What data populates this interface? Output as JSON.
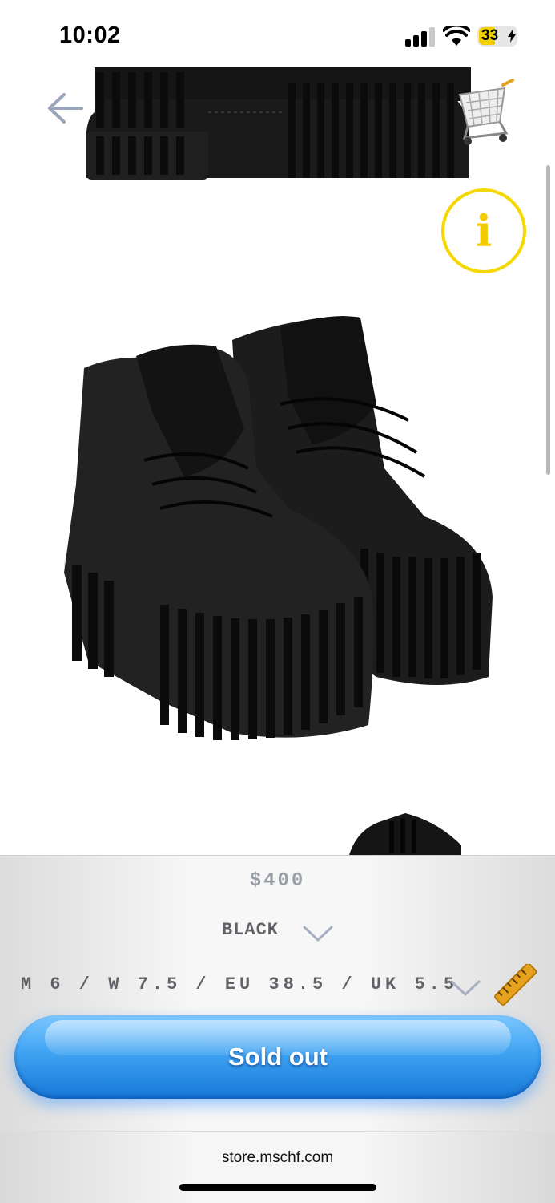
{
  "status_bar": {
    "time": "10:02",
    "signal_icon": "cellular-signal-icon",
    "wifi_icon": "wifi-icon",
    "battery_level": "33",
    "battery_charging": true,
    "battery_color": "#f5d000"
  },
  "gallery": {
    "images": [
      {
        "icon": "boot-side-view-image"
      },
      {
        "icon": "boot-pair-image"
      },
      {
        "icon": "boot-partial-image"
      }
    ],
    "back_icon": "arrow-left-icon",
    "cart_icon": "shopping-cart-icon",
    "info_icon": "info-icon",
    "info_glyph": "i",
    "accent_color": "#f5d800"
  },
  "purchase": {
    "price": "$400",
    "color_selected": "BLACK",
    "size_selected": "M 6 / W 7.5 / EU 38.5 / UK 5.5",
    "ruler_icon": "ruler-icon",
    "button_label": "Sold out",
    "button_color": "#3fa3f2"
  },
  "browser": {
    "url": "store.mschf.com"
  }
}
